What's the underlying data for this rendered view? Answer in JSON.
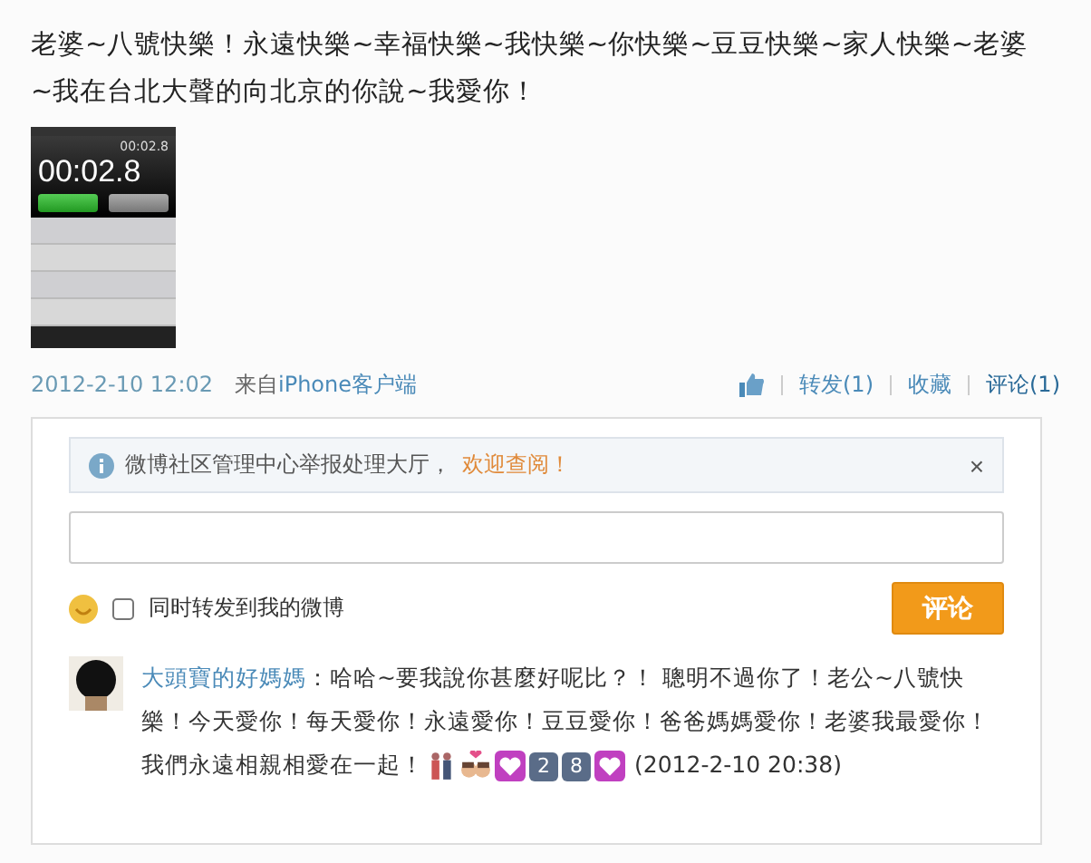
{
  "post": {
    "text": "老婆~八號快樂！永遠快樂~幸福快樂~我快樂~你快樂~豆豆快樂~家人快樂~老婆~我在台北大聲的向北京的你說~我愛你！",
    "photo": {
      "lap_time": "00:02.8",
      "main_time": "00:02.8"
    },
    "time": "2012-2-10 12:02",
    "source_prefix": "来自",
    "source": "iPhone客户端",
    "actions": [
      {
        "label": "转发(1)",
        "selected": false
      },
      {
        "label": "收藏",
        "selected": false
      },
      {
        "label": "评论(1)",
        "selected": true
      }
    ]
  },
  "comment_panel": {
    "notice": "微博社区管理中心举报处理大厅，",
    "notice_link": "欢迎查阅！",
    "close": "×",
    "repost_label": "同时转发到我的微博",
    "repost_checked": false,
    "submit": "评论",
    "comments": [
      {
        "author": "大頭寶的好媽媽",
        "text": "：哈哈~要我說你甚麼好呢比？！ 聰明不過你了！老公~八號快樂！今天愛你！每天愛你！永遠愛你！豆豆愛你！爸爸媽媽愛你！老婆我最愛你！我們永遠相親相愛在一起！",
        "emoji": [
          {
            "kind": "couple"
          },
          {
            "kind": "kiss"
          },
          {
            "kind": "heart"
          },
          {
            "kind": "keycap",
            "label": "2"
          },
          {
            "kind": "keycap",
            "label": "8"
          },
          {
            "kind": "heart"
          }
        ],
        "time": "(2012-2-10 20:38)"
      }
    ]
  }
}
